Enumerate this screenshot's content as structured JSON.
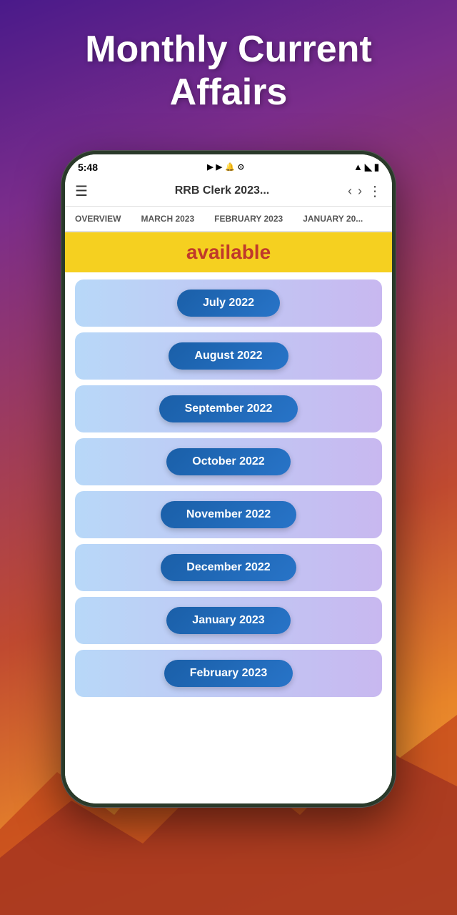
{
  "page": {
    "title": "Monthly Current\nAffairs",
    "background_gradient": "#4a1a8a to #f0a040"
  },
  "status_bar": {
    "time": "5:48",
    "icons": "▶ ▶ 🔔 ⊘",
    "signal": "▲ ◣ 🔋"
  },
  "app_header": {
    "title": "RRB Clerk 2023...",
    "menu_icon": "☰",
    "back_arrow": "‹",
    "forward_arrow": "›",
    "more_icon": "⋮"
  },
  "tabs": [
    {
      "label": "OVERVIEW",
      "active": false
    },
    {
      "label": "MARCH 2023",
      "active": false
    },
    {
      "label": "FEBRUARY 2023",
      "active": false
    },
    {
      "label": "JANUARY 20...",
      "active": false
    }
  ],
  "banner": {
    "text": "available"
  },
  "months": [
    {
      "label": "July 2022"
    },
    {
      "label": "August 2022"
    },
    {
      "label": "September 2022"
    },
    {
      "label": "October 2022"
    },
    {
      "label": "November 2022"
    },
    {
      "label": "December 2022"
    },
    {
      "label": "January 2023"
    },
    {
      "label": "February 2023"
    }
  ]
}
